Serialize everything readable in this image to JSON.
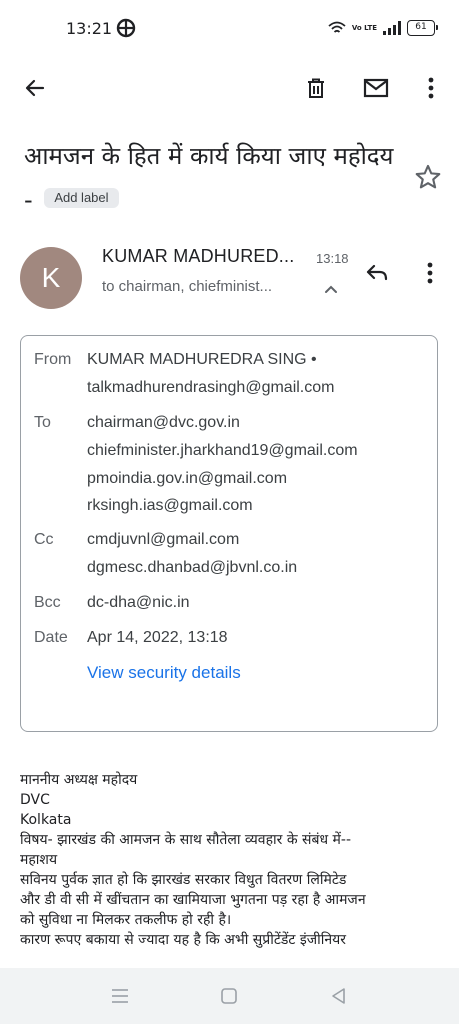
{
  "status_bar": {
    "time": "13:21",
    "battery": "61",
    "network_label": "Vo LTE"
  },
  "toolbar": {
    "back_icon": "arrow-left-icon",
    "delete_icon": "trash-icon",
    "mark_unread_icon": "envelope-icon",
    "more_icon": "more-vert-icon"
  },
  "subject": {
    "text": "आमजन के हित में कार्य किया जाए महोदय -",
    "label_chip": "Add label"
  },
  "sender": {
    "avatar_letter": "K",
    "avatar_color": "#a1887f",
    "name": "KUMAR MADHURED...",
    "time": "13:18",
    "recipients_summary": "to chairman, chiefminist..."
  },
  "details": {
    "from_label": "From",
    "from_name": "KUMAR MADHUREDRA SING •",
    "from_email": "talkmadhurendrasingh@gmail.com",
    "to_label": "To",
    "to": [
      "chairman@dvc.gov.in",
      "chiefminister.jharkhand19@gmail.com",
      "pmoindia.gov.in@gmail.com",
      "rksingh.ias@gmail.com"
    ],
    "cc_label": "Cc",
    "cc": [
      "cmdjuvnl@gmail.com",
      "dgmesc.dhanbad@jbvnl.co.in"
    ],
    "bcc_label": "Bcc",
    "bcc": "dc-dha@nic.in",
    "date_label": "Date",
    "date": "Apr 14, 2022, 13:18",
    "security_link": "View security details",
    "link_color": "#1a73e8"
  },
  "body": {
    "lines": [
      "माननीय अध्यक्ष महोदय",
      "DVC",
      "Kolkata",
      "विषय- झारखंड की आमजन के साथ सौतेला व्यवहार के संबंध में--",
      "महाशय",
      "सविनय पुर्वक ज्ञात हो कि झारखंड सरकार विधुत वितरण लिमिटेड",
      "और डी वी सी में खींचतान का खामियाजा भुगतना पड़ रहा है आमजन",
      "को सुविधा ना मिलकर तकलीफ हो रही है।",
      "कारण रूपए बकाया से ज्यादा यह है कि  अभी सुप्रीटेंडेंट इंजीनियर"
    ]
  },
  "nav_bar": {
    "recents_icon": "menu-lines-icon",
    "home_icon": "square-home-icon",
    "back_icon": "triangle-back-icon"
  }
}
